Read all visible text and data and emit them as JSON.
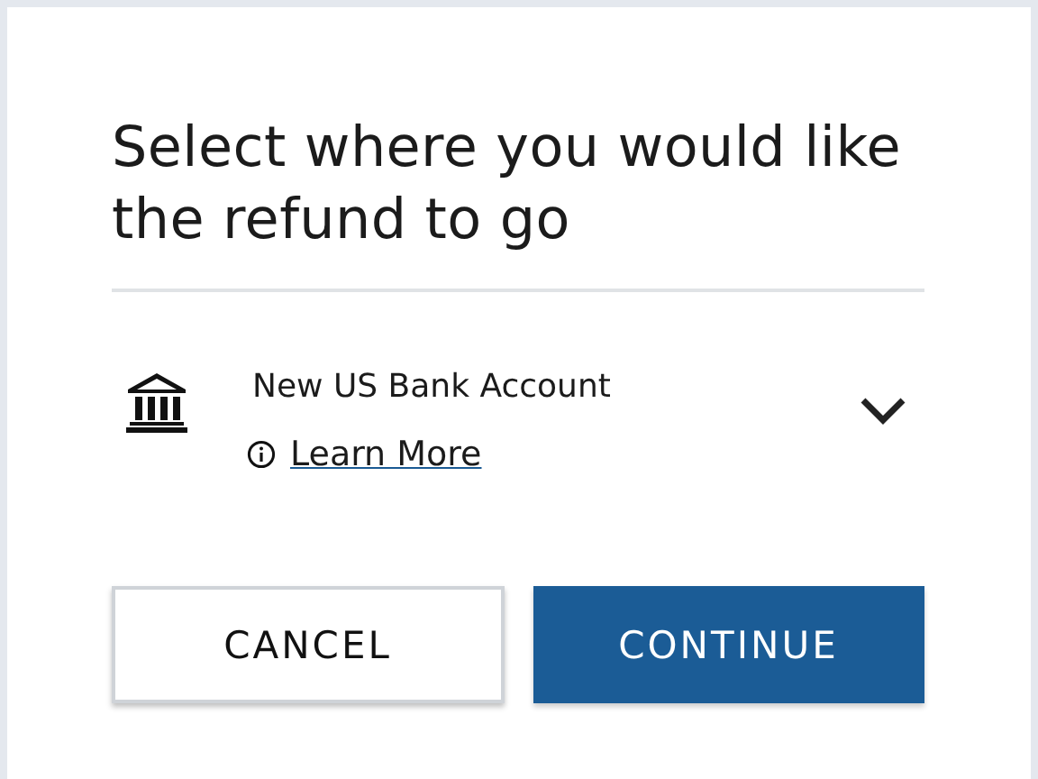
{
  "title": "Select where you would like the refund to go",
  "destination": {
    "label": "New US Bank Account",
    "expanded": false,
    "link": "Learn More"
  },
  "buttons": [
    {
      "label": "CANCEL",
      "kind": "secondary"
    },
    {
      "label": "CONTINUE",
      "kind": "primary"
    }
  ]
}
